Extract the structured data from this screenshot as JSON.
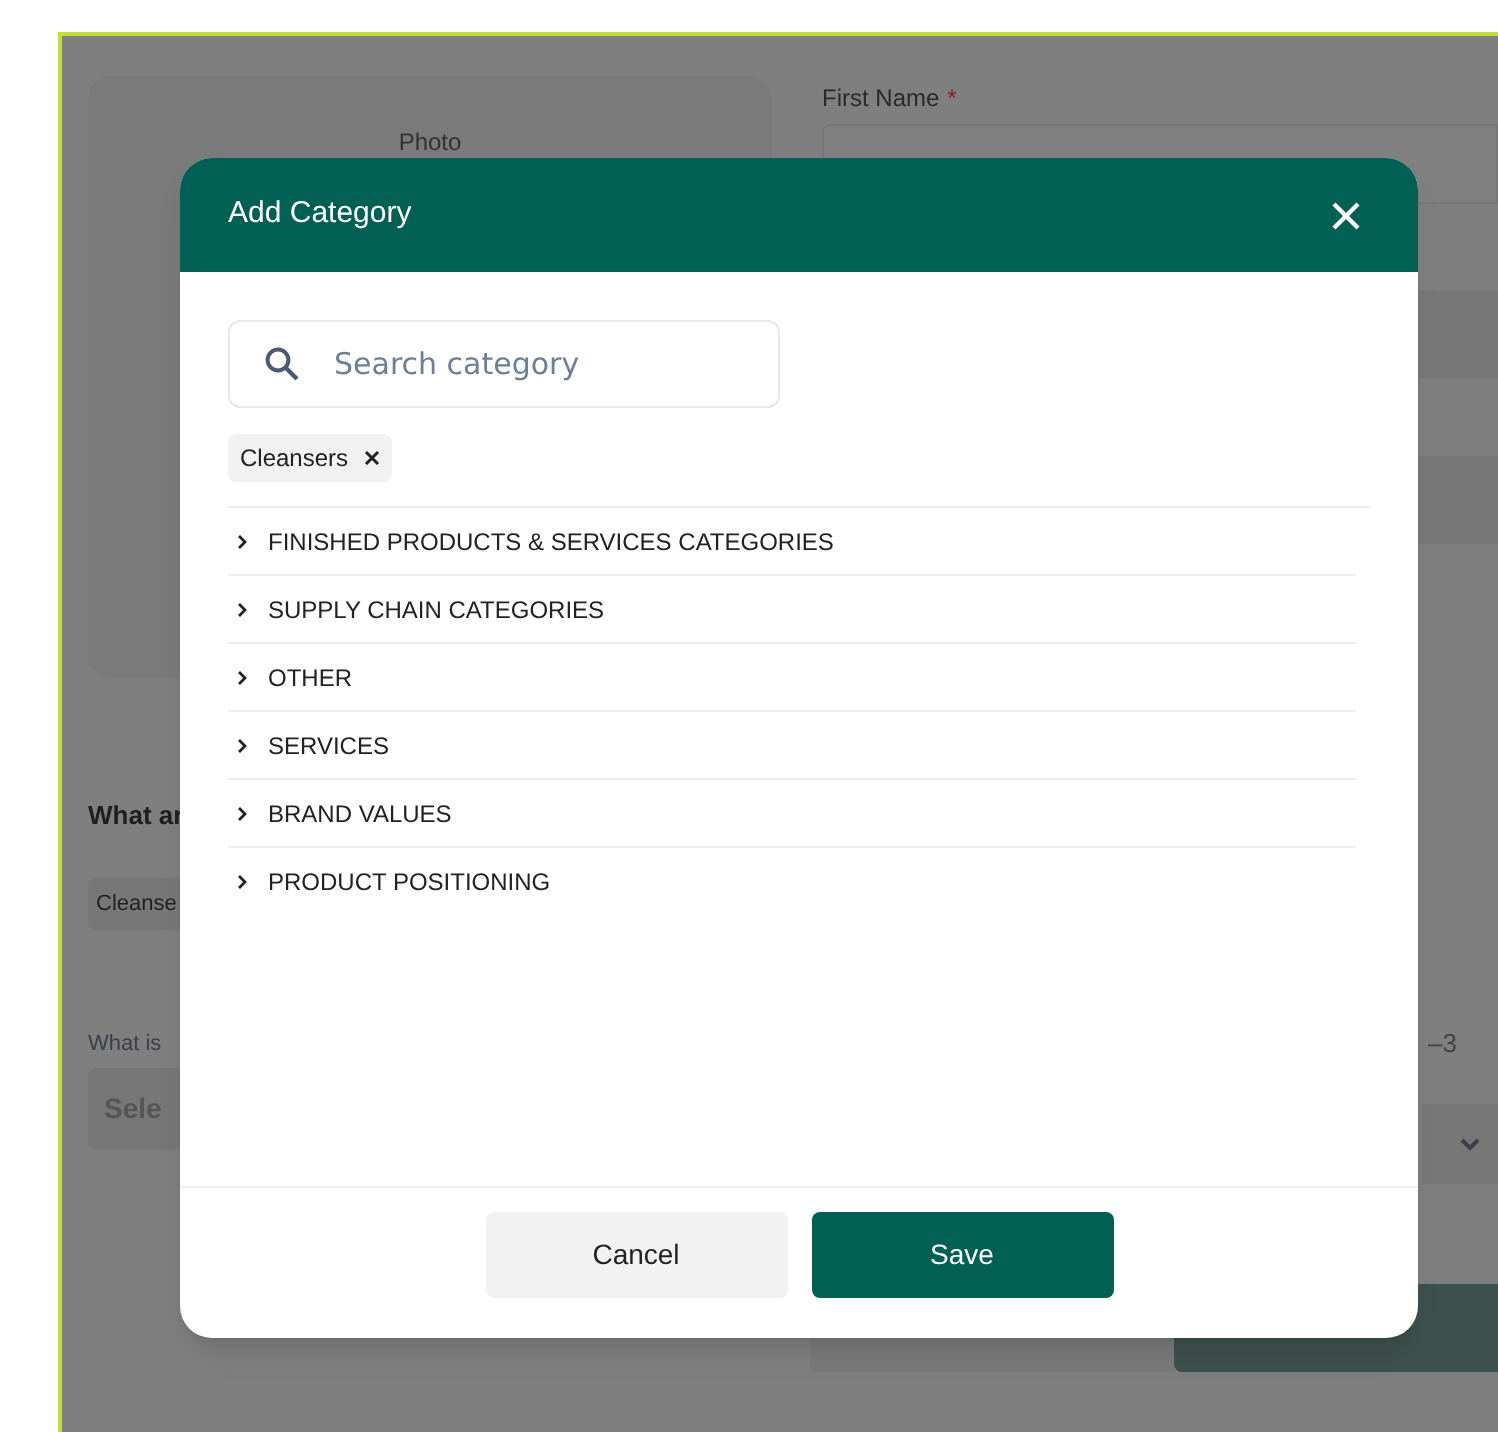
{
  "background_form": {
    "photo_label": "Photo",
    "first_name_label": "First Name",
    "required_mark": "*",
    "question_1": "What ar",
    "chip": "Cleanse",
    "question_2": "What is",
    "select_placeholder": "Sele",
    "right_label": "–3"
  },
  "modal": {
    "title": "Add Category",
    "search": {
      "placeholder": "Search category"
    },
    "selected_tags": [
      {
        "label": "Cleansers"
      }
    ],
    "categories": [
      {
        "label": "FINISHED PRODUCTS & SERVICES CATEGORIES",
        "expanded": false
      },
      {
        "label": "SUPPLY CHAIN CATEGORIES",
        "expanded": false
      },
      {
        "label": "OTHER",
        "expanded": false
      },
      {
        "label": "SERVICES",
        "expanded": false
      },
      {
        "label": "BRAND VALUES",
        "expanded": false
      },
      {
        "label": "PRODUCT POSITIONING",
        "expanded": false
      }
    ],
    "buttons": {
      "cancel": "Cancel",
      "save": "Save"
    }
  }
}
